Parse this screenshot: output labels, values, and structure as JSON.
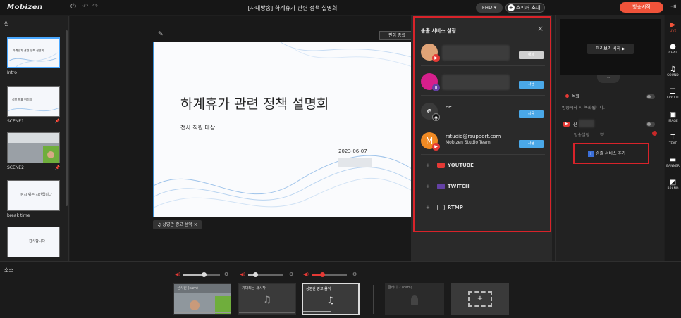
{
  "topbar": {
    "logo": "Mobizen",
    "title": "[사내방송] 하계휴가 관련 정책 설명회",
    "quality": "FHD",
    "invite_label": "스피커 초대",
    "live_label": "방송시작"
  },
  "scenes": {
    "title": "씬",
    "items": [
      {
        "label": "Intro",
        "thumb_text": "하계휴가 관련 정책 설명회"
      },
      {
        "label": "SCENE1",
        "thumb_text": "정보 발표 이미지"
      },
      {
        "label": "SCENE2",
        "thumb_text": ""
      },
      {
        "label": "break time",
        "thumb_text": "잠시 쉬는 시간입니다"
      },
      {
        "label": "",
        "thumb_text": "감사합니다"
      }
    ]
  },
  "stage": {
    "edit_label": "편집 종료",
    "slide_title": "하계휴가 관련 정책 설명회",
    "slide_subtitle": "전사 직원 대상",
    "slide_date": "2023-06-07",
    "music_tag": "상영관 광고 음악",
    "music_close": "×"
  },
  "modal": {
    "title": "송출 서비스 설정",
    "close": "×",
    "accounts": [
      {
        "name1": "",
        "name2": "",
        "button": "해제",
        "active": false,
        "badge": "youtube"
      },
      {
        "name1": "",
        "name2": "",
        "button": "사용",
        "active": true,
        "badge": "twitch"
      },
      {
        "name1": "ee",
        "name2": "",
        "button": "사용",
        "active": true,
        "badge": "rtmp"
      },
      {
        "name1": "rstudio@rsupport.com",
        "name2": "Mobizen Studio Team",
        "button": "사용",
        "active": true,
        "badge": "youtube"
      }
    ],
    "services": [
      {
        "name": "YOUTUBE",
        "icon": "youtube-icon",
        "color": "#e53935"
      },
      {
        "name": "TWITCH",
        "icon": "twitch-icon",
        "color": "#6441a5"
      },
      {
        "name": "RTMP",
        "icon": "rtmp-icon",
        "color": "#555555"
      }
    ],
    "plus": "+"
  },
  "right_panel": {
    "preview_label": "미리보기 시작 ▶",
    "collapse": "⌃",
    "record_label": "녹화",
    "record_desc": "방송시작 시 녹화됩니다.",
    "yt_label": "신",
    "settings_label": "방송설정",
    "add_service": "송출 서비스 추가"
  },
  "rail": [
    {
      "label": "LIVE",
      "glyph": "▶"
    },
    {
      "label": "CHAT",
      "glyph": "●"
    },
    {
      "label": "SOUND",
      "glyph": "♫"
    },
    {
      "label": "LAYOUT",
      "glyph": "☰"
    },
    {
      "label": "IMAGE",
      "glyph": "▣"
    },
    {
      "label": "TEXT",
      "glyph": "T"
    },
    {
      "label": "BANNER",
      "glyph": "▬"
    },
    {
      "label": "BRAND",
      "glyph": "◩"
    }
  ],
  "sources": {
    "title": "소스",
    "items": [
      {
        "name": "신사원 (cam)",
        "volume": 0.55,
        "active": false
      },
      {
        "name": "기대되는 새시작",
        "volume": 0.2,
        "active": false
      },
      {
        "name": "상영관 광고 음악",
        "volume": 0.3,
        "active": true
      }
    ],
    "camera_item": "글래디나 (cam)",
    "add_symbol": "+"
  },
  "colors": {
    "accent": "#4aa8e8",
    "live": "#f0533a",
    "highlight": "#d8232a"
  }
}
